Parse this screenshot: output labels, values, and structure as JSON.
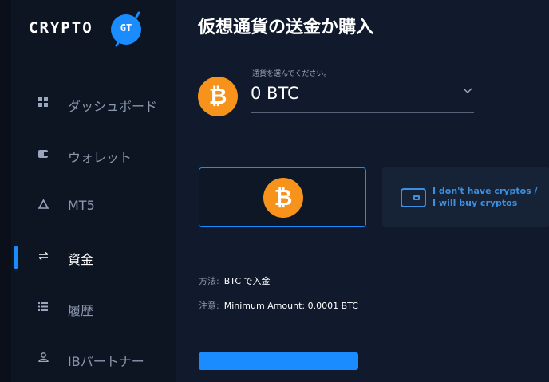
{
  "logo": {
    "text": "CRYPTO",
    "badge": "GT"
  },
  "sidebar": {
    "items": [
      {
        "label": "ダッシュボード",
        "icon": "grid-icon"
      },
      {
        "label": "ウォレット",
        "icon": "wallet-icon"
      },
      {
        "label": "MT5",
        "icon": "triangle-icon"
      },
      {
        "label": "資金",
        "icon": "transfer-icon",
        "active": true
      },
      {
        "label": "履歴",
        "icon": "list-icon"
      },
      {
        "label": "IBパートナー",
        "icon": "partner-icon"
      }
    ]
  },
  "page": {
    "title": "仮想通貨の送金か購入"
  },
  "currency_select": {
    "label": "通貨を選んでください。",
    "value": "0 BTC",
    "icon": "bitcoin-icon"
  },
  "options": {
    "buy_line1": "I don't have cryptos /",
    "buy_line2": "I will buy cryptos"
  },
  "info": {
    "method_key": "方法:",
    "method_value": "BTC で入金",
    "note_key": "注意:",
    "note_value": "Minimum Amount: 0.0001 BTC"
  },
  "colors": {
    "accent": "#1a8cff",
    "bitcoin": "#f7931a",
    "background": "#111a2c",
    "sidebar": "#0d1523"
  }
}
